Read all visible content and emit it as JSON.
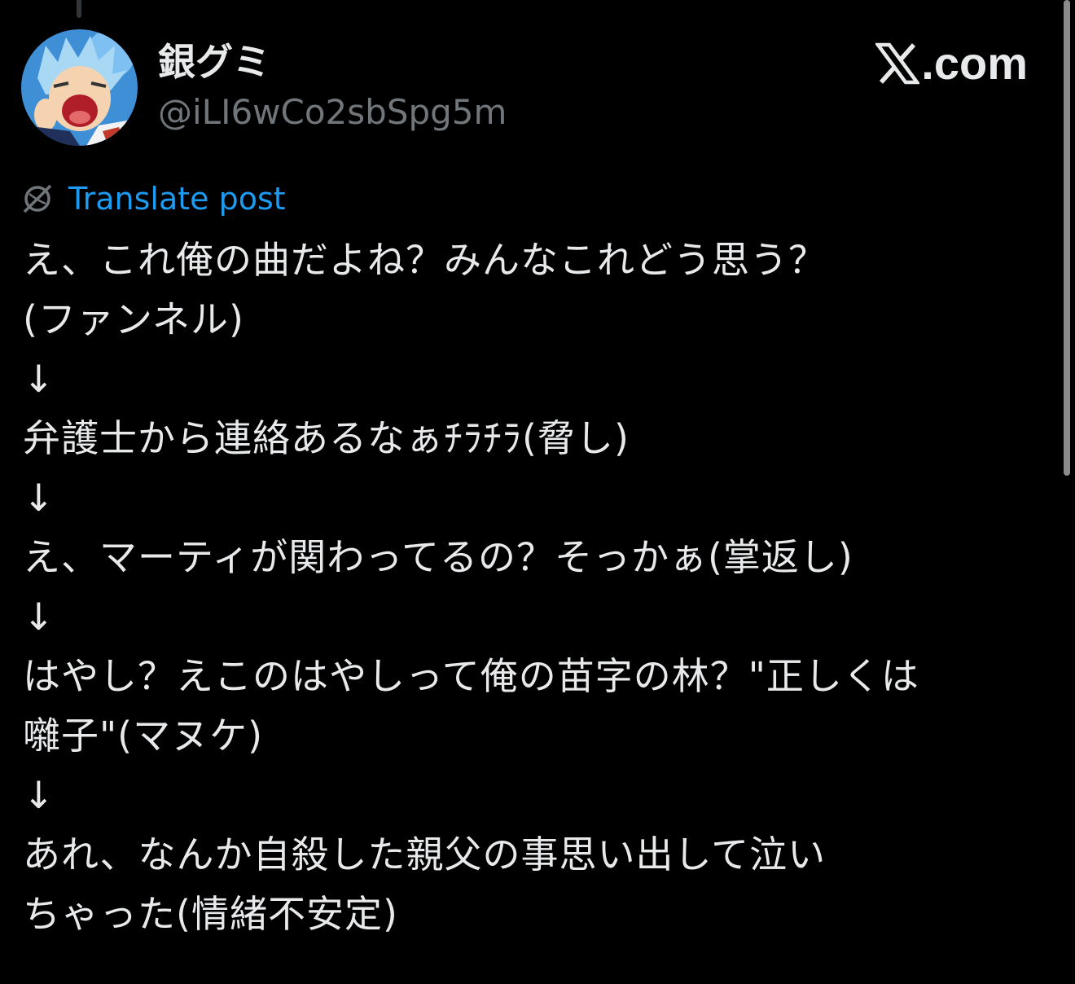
{
  "post": {
    "author": {
      "display_name": "銀グミ",
      "handle": "@iLI6wCo2sbSpg5m",
      "avatar_icon": "avatar-anime-character"
    },
    "brand": {
      "text": ".com",
      "logo_icon": "x-logo-icon"
    },
    "translate": {
      "label": "Translate post",
      "icon": "globe-icon"
    },
    "lines": [
      "え、これ俺の曲だよね？みんなこれどう思う？",
      "(ファンネル)",
      "↓",
      "弁護士から連絡あるなぁﾁﾗﾁﾗ(脅し)",
      "↓",
      "え、マーティが関わってるの？そっかぁ(掌返し)",
      "↓",
      "はやし？えこのはやしって俺の苗字の林？\"正しくは",
      "囃子\"(マヌケ)",
      "↓",
      "あれ、なんか自殺した親父の事思い出して泣い",
      "ちゃった(情緒不安定)"
    ]
  },
  "colors": {
    "background": "#000000",
    "text": "#e7e9ea",
    "muted": "#71767b",
    "link": "#1d9bf0"
  }
}
